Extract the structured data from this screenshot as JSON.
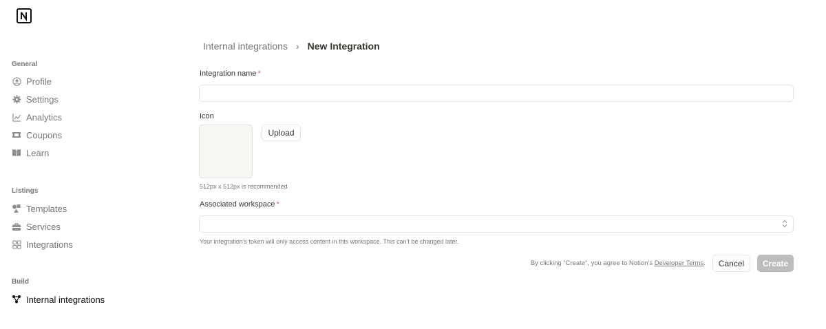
{
  "sidebar": {
    "sections": [
      {
        "title": "General",
        "items": [
          {
            "label": "Profile",
            "icon": "profile-icon"
          },
          {
            "label": "Settings",
            "icon": "gear-icon"
          },
          {
            "label": "Analytics",
            "icon": "analytics-icon"
          },
          {
            "label": "Coupons",
            "icon": "ticket-icon"
          },
          {
            "label": "Learn",
            "icon": "book-icon"
          }
        ]
      },
      {
        "title": "Listings",
        "items": [
          {
            "label": "Templates",
            "icon": "shapes-icon"
          },
          {
            "label": "Services",
            "icon": "briefcase-icon"
          },
          {
            "label": "Integrations",
            "icon": "grid-icon"
          }
        ]
      },
      {
        "title": "Build",
        "items": [
          {
            "label": "Internal integrations",
            "icon": "graph-icon",
            "active": true
          }
        ]
      }
    ]
  },
  "breadcrumb": {
    "parent": "Internal integrations",
    "separator": "›",
    "current": "New Integration"
  },
  "form": {
    "integration_name_label": "Integration name",
    "required_marker": "*",
    "integration_name_value": "",
    "icon_label": "Icon",
    "upload_label": "Upload",
    "icon_hint": "512px x 512px is recommended",
    "workspace_label": "Associated workspace",
    "workspace_value": "",
    "workspace_hint": "Your integration’s token will only access content in this workspace. This can’t be changed later."
  },
  "footer": {
    "terms_prefix": "By clicking “Create”, you agree to Notion’s ",
    "terms_link": "Developer Terms",
    "terms_suffix": ".",
    "cancel_label": "Cancel",
    "create_label": "Create"
  },
  "colors": {
    "required": "#eb5757",
    "muted_text": "#787774",
    "disabled_button": "#bdbdbb"
  }
}
